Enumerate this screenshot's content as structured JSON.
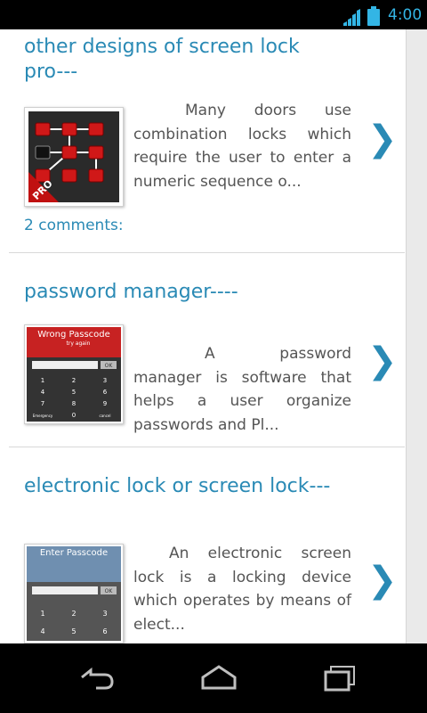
{
  "status": {
    "time": "4:00",
    "signal_icon": "signal-icon",
    "battery_icon": "battery-icon",
    "accent_color": "#33b5e5"
  },
  "posts": [
    {
      "title": "other designs of screen lock pro---",
      "excerpt": "Many doors use combination locks which require the user to enter a numeric sequence o...",
      "comments": "2 comments:",
      "thumbnail": {
        "badge": "PRO"
      }
    },
    {
      "title": "password manager----",
      "excerpt": "A password manager is software that helps a user organize passwords and Pl...",
      "thumbnail": {
        "header": "Wrong Passcode",
        "subheader": "try again",
        "keys": [
          "1",
          "2",
          "3",
          "4",
          "5",
          "6",
          "7",
          "8",
          "9",
          "Emergency",
          "0",
          "cancel"
        ],
        "ok": "OK"
      }
    },
    {
      "title": "electronic lock or screen lock---",
      "excerpt": "An electronic screen lock is a locking device which operates by means of elect...",
      "thumbnail": {
        "header": "Enter Passcode",
        "keys": [
          "1",
          "2",
          "3",
          "4",
          "5",
          "6"
        ],
        "ok": "OK"
      }
    }
  ],
  "nav": {
    "back_icon": "back-icon",
    "home_icon": "home-icon",
    "recents_icon": "recents-icon"
  },
  "colors": {
    "link": "#2a8ab5",
    "text": "#555555"
  }
}
